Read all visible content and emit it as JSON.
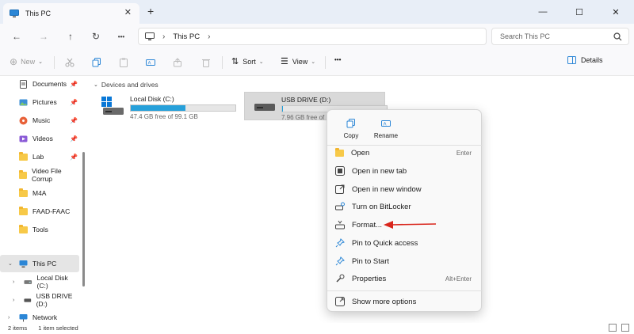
{
  "tab": {
    "title": "This PC",
    "close": "✕",
    "new": "+"
  },
  "window": {
    "minimize": "—",
    "maximize": "☐",
    "close": "✕"
  },
  "address": {
    "location": "This PC",
    "separator": "›",
    "trailing": "›",
    "search_placeholder": "Search This PC"
  },
  "nav": {
    "back": "←",
    "forward": "→",
    "up": "↑",
    "refresh": "↻",
    "more": "•••"
  },
  "commands": {
    "new": "New",
    "sort": "Sort",
    "view": "View",
    "more": "•••",
    "details": "Details"
  },
  "sidebar": {
    "items": [
      {
        "label": "Documents",
        "icon": "documents-icon",
        "pinned": true
      },
      {
        "label": "Pictures",
        "icon": "pictures-icon",
        "pinned": true
      },
      {
        "label": "Music",
        "icon": "music-icon",
        "pinned": true
      },
      {
        "label": "Videos",
        "icon": "videos-icon",
        "pinned": true
      },
      {
        "label": "Lab",
        "icon": "folder-icon",
        "pinned": true
      },
      {
        "label": "Video File Corrup",
        "icon": "folder-icon",
        "pinned": false
      },
      {
        "label": "M4A",
        "icon": "folder-icon",
        "pinned": false
      },
      {
        "label": "FAAD-FAAC",
        "icon": "folder-icon",
        "pinned": false
      },
      {
        "label": "Tools",
        "icon": "folder-icon",
        "pinned": false
      }
    ],
    "this_pc": "This PC",
    "drives": [
      "Local Disk (C:)",
      "USB DRIVE (D:)"
    ],
    "network": "Network"
  },
  "content": {
    "group": "Devices and drives",
    "drives": [
      {
        "name": "Local Disk (C:)",
        "free": "47.4 GB free of 99.1 GB",
        "used_fraction": 0.52
      },
      {
        "name": "USB DRIVE (D:)",
        "free": "7.96 GB free of 7",
        "used_fraction": 0.01
      }
    ]
  },
  "status": {
    "items": "2 items",
    "selected": "1 item selected"
  },
  "context_menu": {
    "top": [
      {
        "label": "Copy"
      },
      {
        "label": "Rename"
      }
    ],
    "items": [
      {
        "label": "Open",
        "shortcut": "Enter"
      },
      {
        "label": "Open in new tab",
        "shortcut": ""
      },
      {
        "label": "Open in new window",
        "shortcut": ""
      },
      {
        "label": "Turn on BitLocker",
        "shortcut": ""
      },
      {
        "label": "Format...",
        "shortcut": ""
      },
      {
        "label": "Pin to Quick access",
        "shortcut": ""
      },
      {
        "label": "Pin to Start",
        "shortcut": ""
      },
      {
        "label": "Properties",
        "shortcut": "Alt+Enter"
      },
      {
        "label": "Show more options",
        "shortcut": ""
      }
    ]
  },
  "colors": {
    "accent": "#26a0da",
    "arrow": "#d9261c",
    "folder": "#f7c948"
  }
}
